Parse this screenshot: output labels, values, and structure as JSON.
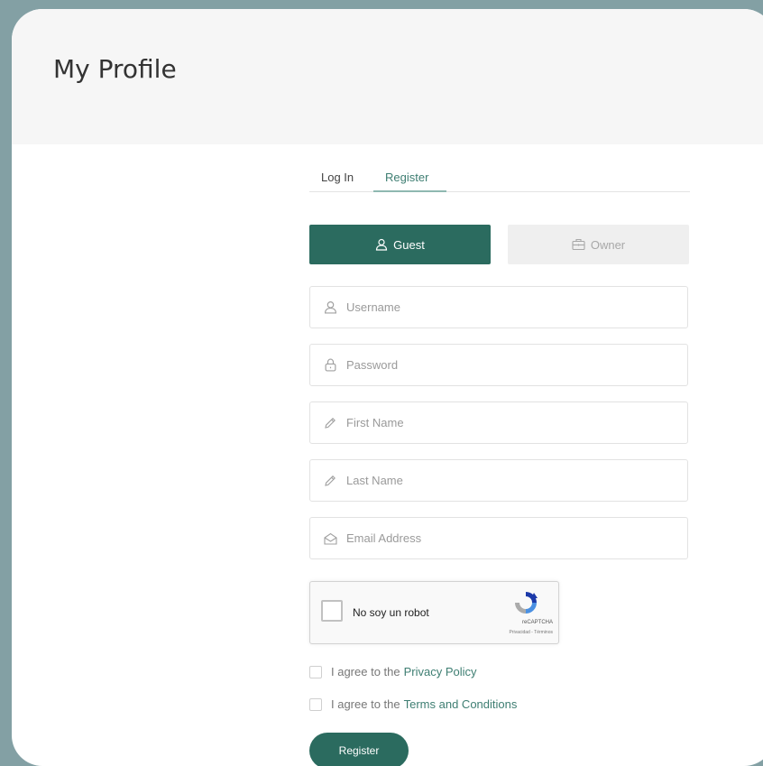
{
  "header": {
    "title": "My Profile"
  },
  "tabs": {
    "login": "Log In",
    "register": "Register",
    "active": "register"
  },
  "roles": {
    "guest": "Guest",
    "owner": "Owner",
    "selected": "guest"
  },
  "fields": {
    "username": {
      "placeholder": "Username",
      "value": ""
    },
    "password": {
      "placeholder": "Password",
      "value": ""
    },
    "first_name": {
      "placeholder": "First Name",
      "value": ""
    },
    "last_name": {
      "placeholder": "Last Name",
      "value": ""
    },
    "email": {
      "placeholder": "Email Address",
      "value": ""
    }
  },
  "recaptcha": {
    "label": "No soy un robot",
    "brand": "reCAPTCHA",
    "links": "Privacidad - Términos"
  },
  "agreements": {
    "privacy_prefix": "I agree to the",
    "privacy_link": "Privacy Policy",
    "terms_prefix": "I agree to the",
    "terms_link": "Terms and Conditions"
  },
  "submit": {
    "label": "Register"
  },
  "colors": {
    "accent": "#2b6b5f",
    "link": "#3e7e72",
    "page_bg": "#83a0a4",
    "header_bg": "#f6f6f6"
  }
}
